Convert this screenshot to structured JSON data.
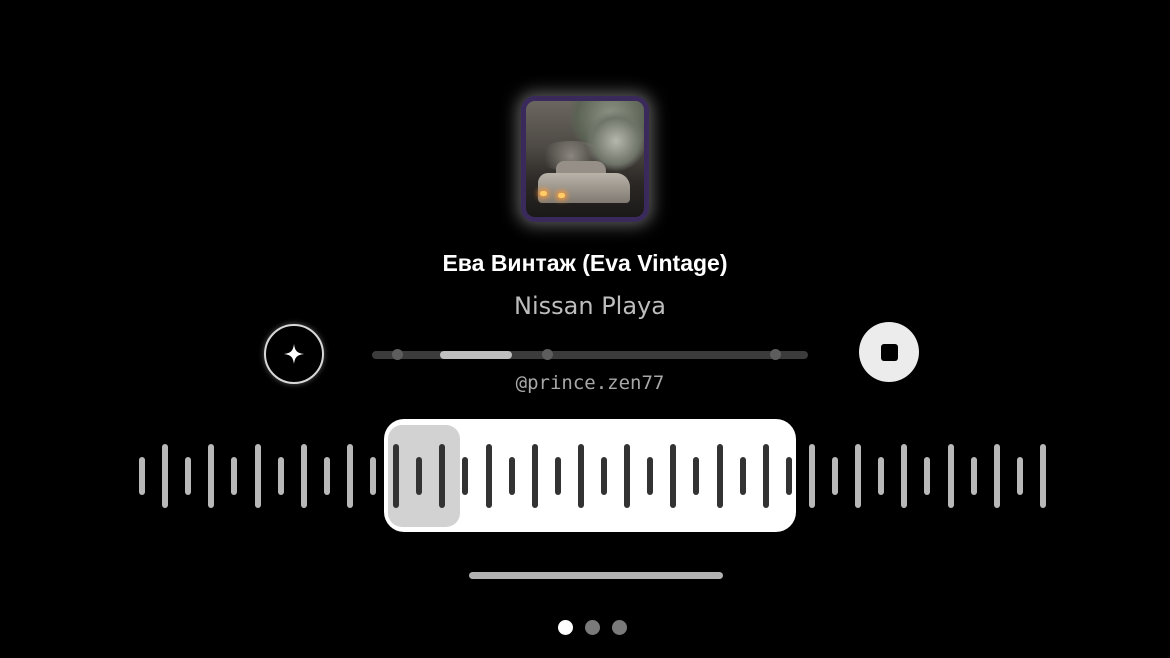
{
  "track": {
    "title": "Ева Винтаж (Eva Vintage)",
    "artist": "Nissan Playa",
    "handle": "@prince.zen77"
  },
  "colors": {
    "background": "#000000",
    "cover_frame": "#3a2a5c",
    "waveform_active": "#333333",
    "waveform_inactive": "#b8b8b8"
  },
  "controls": {
    "sparkle_icon": "sparkle-icon",
    "stop_icon": "stop-icon"
  },
  "progress": {
    "selection_start": 0.155,
    "selection_end": 0.32
  },
  "pager": {
    "pages": 3,
    "current": 1
  }
}
